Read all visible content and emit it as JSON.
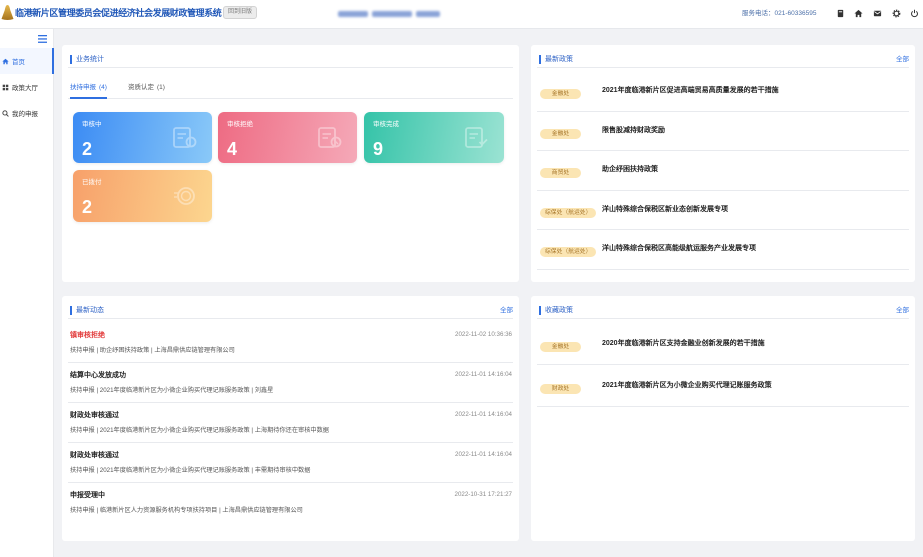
{
  "header": {
    "title": "临港新片区管理委员会促进经济社会发展财政管理系统",
    "old_version_button": "回到旧版",
    "service_phone": "服务电话：021-60336595",
    "toolbar_icons": [
      "book-icon",
      "home-icon",
      "mail-icon",
      "gear-icon",
      "power-icon"
    ]
  },
  "sidebar": {
    "toggle_icon": "menu-icon",
    "items": [
      {
        "label": "首页",
        "icon": "home-icon",
        "active": true
      },
      {
        "label": "政策大厅",
        "icon": "grid-icon",
        "active": false
      },
      {
        "label": "我的申报",
        "icon": "search-icon",
        "active": false
      }
    ]
  },
  "business_stats": {
    "title": "业务统计",
    "tabs": [
      {
        "label": "扶持申报",
        "count": "(4)",
        "active": true
      },
      {
        "label": "资质认定",
        "count": "(1)",
        "active": false
      }
    ],
    "tiles": [
      {
        "label": "审核中",
        "value": "2",
        "icon": "document-search-icon"
      },
      {
        "label": "审核拒绝",
        "value": "4",
        "icon": "document-reject-icon"
      },
      {
        "label": "审核完成",
        "value": "9",
        "icon": "document-check-icon"
      },
      {
        "label": "已拨付",
        "value": "2",
        "icon": "coins-icon"
      }
    ]
  },
  "latest_policies": {
    "title": "最新政策",
    "more_link": "全部",
    "items": [
      {
        "dept": "金融处",
        "title": "2021年度临港新片区促进高端贸易高质量发展的若干措施"
      },
      {
        "dept": "金融处",
        "title": "限售股减持财政奖励"
      },
      {
        "dept": "商贸处",
        "title": "助企纾困扶持政策"
      },
      {
        "dept": "综保处（航运处）",
        "title": "洋山特殊综合保税区新业态创新发展专项"
      },
      {
        "dept": "综保处（航运处）",
        "title": "洋山特殊综合保税区高能级航运服务产业发展专项"
      }
    ]
  },
  "latest_updates": {
    "title": "最新动态",
    "more_link": "全部",
    "items": [
      {
        "status": "镇审核拒绝",
        "time": "2022-11-02 10:36:36",
        "detail": "扶持申报 | 助企纾困扶持政策 | 上海昌鼎供应链管理有限公司"
      },
      {
        "status": "结算中心发放成功",
        "time": "2022-11-01 14:16:04",
        "detail": "扶持申报 | 2021年度临港新片区为小微企业购买代理记账服务政策 | 刘鑫星"
      },
      {
        "status": "财政处审核通过",
        "time": "2022-11-01 14:16:04",
        "detail": "扶持申报 | 2021年度临港新片区为小微企业购买代理记账服务政策 | 上海期待你还在审核中数据"
      },
      {
        "status": "财政处审核通过",
        "time": "2022-11-01 14:16:04",
        "detail": "扶持申报 | 2021年度临港新片区为小微企业购买代理记账服务政策 | 丰需期待审核中数据"
      },
      {
        "status": "申报受理中",
        "time": "2022-10-31 17:21:27",
        "detail": "扶持申报 | 临港新片区人力资源服务机构专项扶持项目 | 上海昌鼎供应链管理有限公司"
      }
    ]
  },
  "favorite_policies": {
    "title": "收藏政策",
    "more_link": "全部",
    "items": [
      {
        "dept": "金融处",
        "title": "2020年度临港新片区支持金融业创新发展的若干措施"
      },
      {
        "dept": "财政处",
        "title": "2021年度临港新片区为小微企业购买代理记账服务政策"
      }
    ]
  },
  "colors": {
    "brand_blue": "#2f6fe0",
    "title_blue": "#2158b8",
    "rejected_red": "#e23b3b",
    "badge_bg": "#fbe5b3",
    "badge_text": "#a7762a",
    "page_bg": "#f1f2f5"
  }
}
